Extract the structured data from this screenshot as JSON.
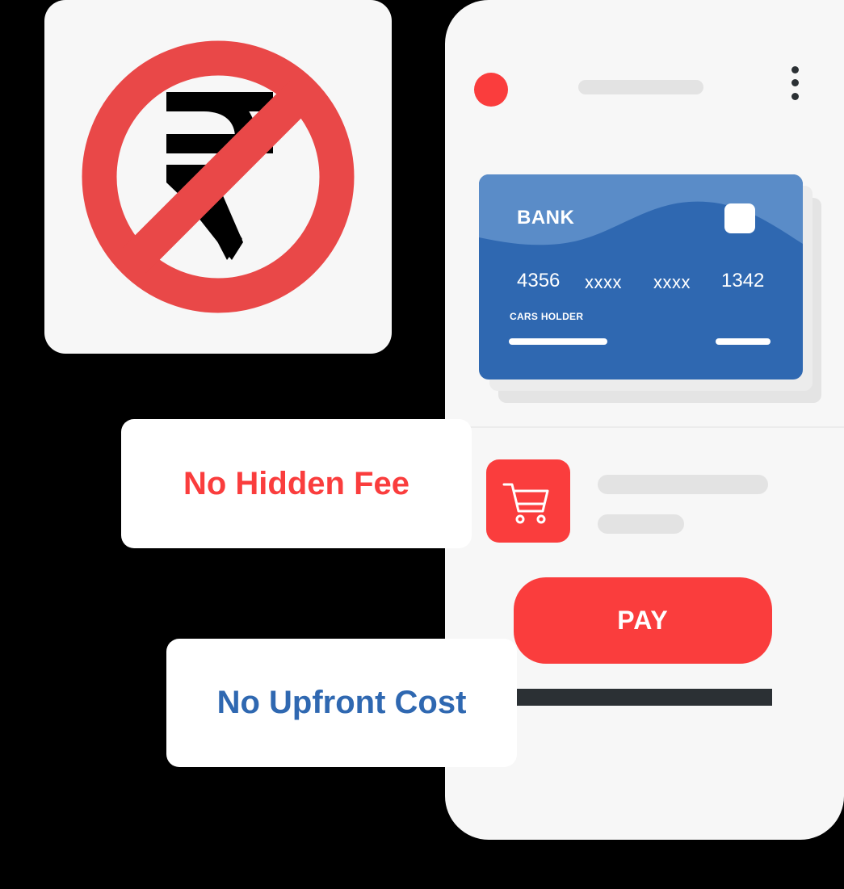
{
  "no_rupee_sign": {
    "icon": "no-rupee-icon",
    "glyph": "₹",
    "colors": {
      "circle": "#e94848",
      "glyph": "#000000"
    }
  },
  "phone": {
    "menu_icon": "kebab-menu-icon",
    "card": {
      "bank_name": "BANK",
      "number_groups": [
        "4356",
        "xxxx",
        "xxxx",
        "1342"
      ],
      "holder_label": "CARS HOLDER",
      "color": "#2f68b1"
    },
    "cart_icon": "shopping-cart-icon",
    "pay_label": "PAY"
  },
  "badges": {
    "hidden_fee": "No Hidden Fee",
    "upfront_cost": "No Upfront Cost"
  },
  "colors": {
    "accent_red": "#fa3d3d",
    "accent_blue": "#2f68b1",
    "dark": "#2b3034"
  }
}
